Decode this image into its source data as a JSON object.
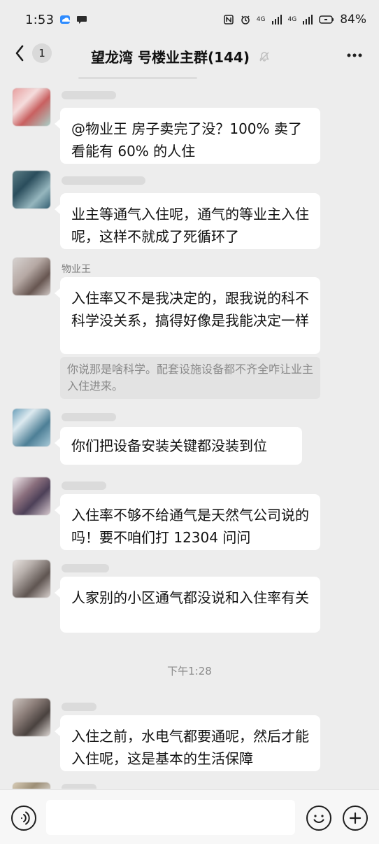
{
  "status_bar": {
    "time": "1:53",
    "network_1": "4G",
    "network_2": "4G",
    "battery": "84%"
  },
  "header": {
    "back_count": "1",
    "title": "望龙湾 号楼业主群(144)"
  },
  "messages": [
    {
      "nickname": "",
      "text": "@物业王  房子卖完了没？100% 卖了看能有 60% 的人住"
    },
    {
      "nickname": "",
      "text": "业主等通气入住呢，通气的等业主入住呢，这样不就成了死循环了"
    },
    {
      "nickname": "物业王",
      "text": "入住率又不是我决定的，跟我说的科不科学没关系，搞得好像是我能决定一样",
      "quote": "你说那是啥科学。配套设施设备都不齐全咋让业主入住进来。"
    },
    {
      "nickname": "",
      "text": "你们把设备安装关键都没装到位"
    },
    {
      "nickname": "",
      "text": "入住率不够不给通气是天然气公司说的吗！要不咱们打 12304 问问"
    },
    {
      "nickname": "",
      "text": "人家别的小区通气都没说和入住率有关"
    },
    {
      "nickname": "",
      "text": "入住之前，水电气都要通呢，然后才能入住呢，这是基本的生活保障"
    }
  ],
  "time_divider": "下午1:28",
  "icons": {
    "voice": "voice-icon",
    "emoji": "emoji-icon",
    "plus": "plus-icon",
    "more": "more-icon",
    "mute": "mute-bell-icon"
  },
  "colors": {
    "background": "#ededed",
    "bubble": "#ffffff",
    "quote_bg": "#e3e3e3",
    "text": "#111111",
    "muted": "#8a8a8a"
  }
}
